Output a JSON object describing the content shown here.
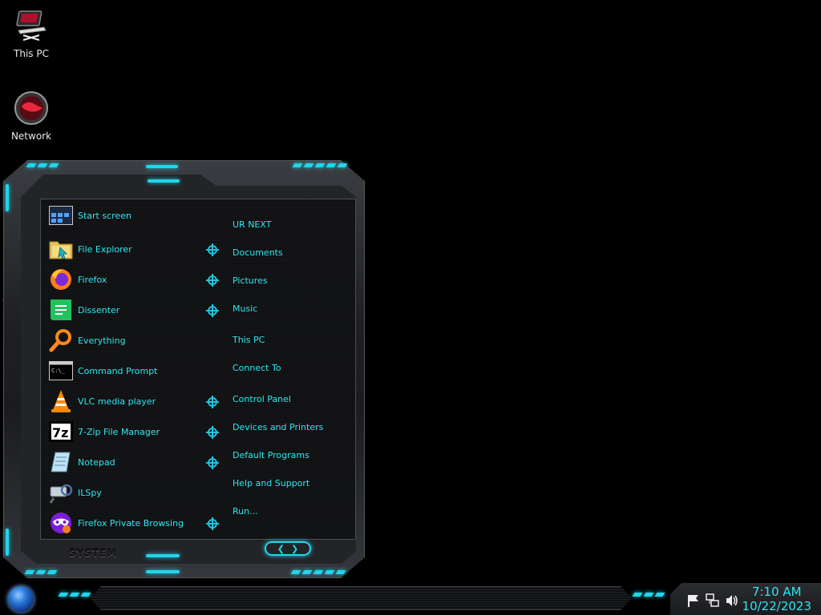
{
  "desktop": {
    "icons": [
      {
        "label": "This PC"
      },
      {
        "label": "Network"
      }
    ],
    "stray_text": "C"
  },
  "start_menu": {
    "programs": [
      {
        "name": "Start screen",
        "icon": "start-screen-icon",
        "has_jumplist": false
      },
      {
        "name": "File Explorer",
        "icon": "folder-icon",
        "has_jumplist": true
      },
      {
        "name": "Firefox",
        "icon": "firefox-icon",
        "has_jumplist": true
      },
      {
        "name": "Dissenter",
        "icon": "dissenter-icon",
        "has_jumplist": true
      },
      {
        "name": "Everything",
        "icon": "magnifier-icon",
        "has_jumplist": false
      },
      {
        "name": "Command Prompt",
        "icon": "terminal-icon",
        "has_jumplist": false
      },
      {
        "name": "VLC media player",
        "icon": "vlc-cone-icon",
        "has_jumplist": true
      },
      {
        "name": "7-Zip File Manager",
        "icon": "7zip-icon",
        "has_jumplist": true
      },
      {
        "name": "Notepad",
        "icon": "notepad-icon",
        "has_jumplist": true
      },
      {
        "name": "ILSpy",
        "icon": "ilspy-icon",
        "has_jumplist": false
      },
      {
        "name": "Firefox Private Browsing",
        "icon": "private-browsing-icon",
        "has_jumplist": true
      }
    ],
    "places": [
      "UR NEXT",
      "Documents",
      "Pictures",
      "Music",
      "This PC",
      "Connect To",
      "Control Panel",
      "Devices and Printers",
      "Default Programs",
      "Help and Support",
      "Run..."
    ],
    "brand_label": "SYSTEM",
    "nav": {
      "left": "❮",
      "right": "❯"
    }
  },
  "taskbar": {
    "clock_time": "7:10 AM",
    "clock_date": "10/22/2023"
  },
  "colors": {
    "accent": "#22d5ea",
    "text": "#2ee6f0"
  }
}
